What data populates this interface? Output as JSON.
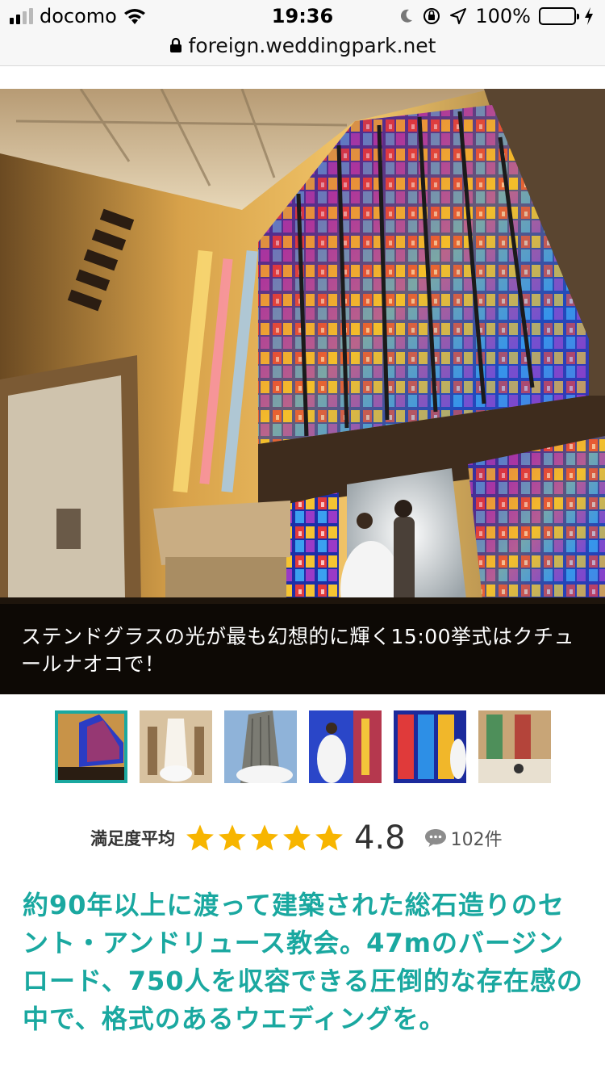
{
  "status_bar": {
    "carrier": "docomo",
    "time": "19:36",
    "battery": "100%",
    "icons": [
      "signal-icon",
      "wifi-icon",
      "moon-icon",
      "orientation-lock-icon",
      "location-icon",
      "battery-icon",
      "charging-icon"
    ]
  },
  "url_bar": {
    "url": "foreign.weddingpark.net",
    "icon": "lock-icon"
  },
  "hero": {
    "caption": "ステンドグラスの光が最も幻想的に輝く15:00挙式はクチュールナオコで！"
  },
  "thumbnails": [
    {
      "alt": "stained-glass-chapel",
      "active": true
    },
    {
      "alt": "chapel-aisle",
      "active": false
    },
    {
      "alt": "church-exterior",
      "active": false
    },
    {
      "alt": "bride-stained-glass",
      "active": false
    },
    {
      "alt": "stained-glass-window",
      "active": false
    },
    {
      "alt": "wedding-party",
      "active": false
    }
  ],
  "rating": {
    "label": "満足度平均",
    "score": "4.8",
    "stars": 4.8,
    "review_count": "102件",
    "star_color": "#f7b500"
  },
  "description": "約90年以上に渡って建築された総石造りのセント・アンドリュース教会。47mのバージンロード、750人を収容できる圧倒的な存在感の中で、格式のあるウエディングを。",
  "colors": {
    "accent": "#1aa8a0"
  }
}
